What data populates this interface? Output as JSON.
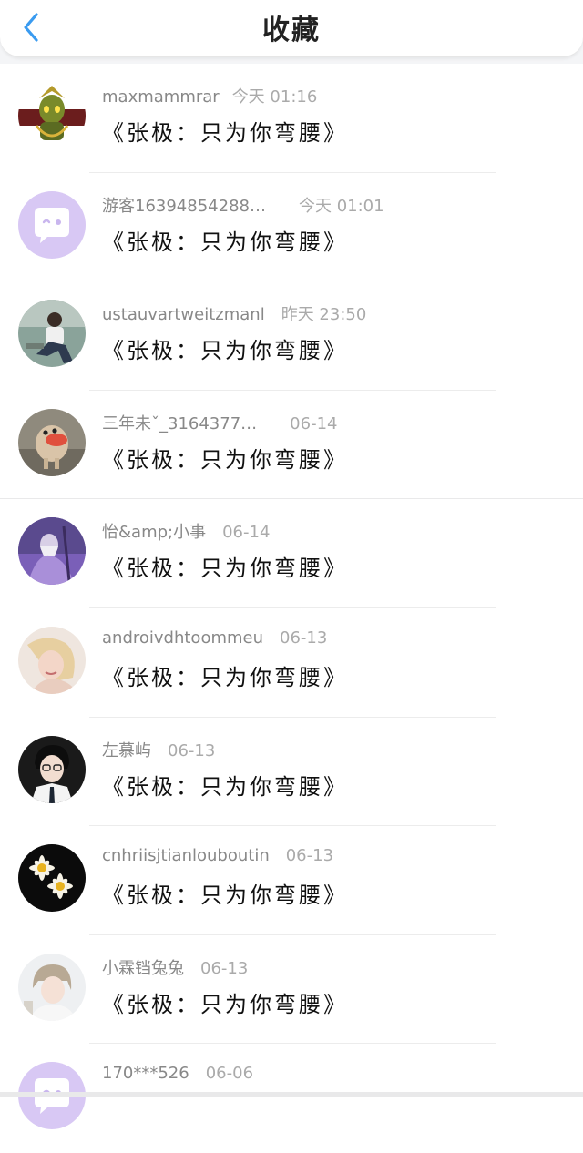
{
  "header": {
    "title": "收藏",
    "back_icon": "chevron-left-icon",
    "accent": "#3a9bf0"
  },
  "items": [
    {
      "user": "maxmammrar",
      "time": "今天 01:16",
      "title": "《张极：只为你弯腰》",
      "avatar": "game-character"
    },
    {
      "user": "游客16394854288…",
      "time": "今天 01:01",
      "title": "《张极：只为你弯腰》",
      "avatar": "default-chat"
    },
    {
      "user": "ustauvartweitzmanl",
      "time": "昨天 23:50",
      "title": "《张极：只为你弯腰》",
      "avatar": "photo-person"
    },
    {
      "user": "三年未ˇ_3164377…",
      "time": "06-14",
      "title": "《张极：只为你弯腰》",
      "avatar": "photo-plush"
    },
    {
      "user": "怡&amp;小事",
      "time": "06-14",
      "title": "《张极：只为你弯腰》",
      "avatar": "photo-wizard"
    },
    {
      "user": "androivdhtoommeu",
      "time": "06-13",
      "title": "《张极：只为你弯腰》",
      "avatar": "photo-woman"
    },
    {
      "user": "左慕屿",
      "time": "06-13",
      "title": "《张极：只为你弯腰》",
      "avatar": "photo-boy"
    },
    {
      "user": "cnhriisjtianlouboutin",
      "time": "06-13",
      "title": "《张极：只为你弯腰》",
      "avatar": "photo-daisies"
    },
    {
      "user": "小霖铛兔兔",
      "time": "06-13",
      "title": "《张极：只为你弯腰》",
      "avatar": "photo-kid"
    },
    {
      "user": "170***526",
      "time": "06-06",
      "title": "",
      "avatar": "default-chat"
    }
  ]
}
